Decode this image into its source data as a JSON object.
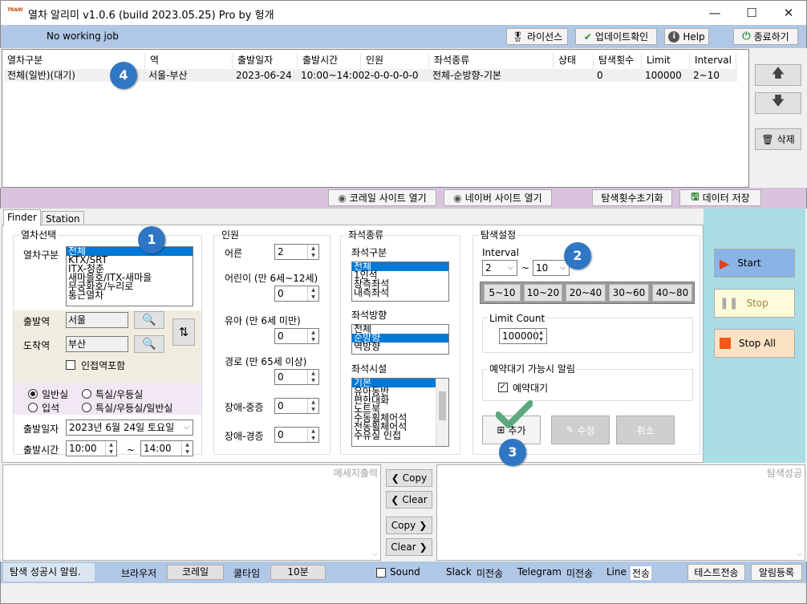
{
  "window": {
    "app_icon_text": "TRAIN",
    "title": "열차 알리미 v1.0.6 (build 2023.05.25) Pro by 헝개",
    "min": "—",
    "max": "☐",
    "close": "✕"
  },
  "statusbar": {
    "text": "No working job",
    "license": "라이선스",
    "update": "업데이트확인",
    "help": "Help",
    "quit": "종료하기"
  },
  "jobs": {
    "columns": [
      "열차구분",
      "역",
      "출발일자",
      "출발시간",
      "인원",
      "좌석종류",
      "상태",
      "탐색횟수",
      "Limit",
      "Interval"
    ],
    "rows": [
      [
        "전체(일반)(대기)",
        "서울-부산",
        "2023-06-24",
        "10:00~14:00",
        "2-0-0-0-0-0",
        "전체-순방향-기본",
        "",
        "0",
        "100000",
        "2~10"
      ]
    ],
    "delete": "삭제"
  },
  "midbar": {
    "korail": "코레일 사이트 열기",
    "naver": "네이버 사이트 열기",
    "reset": "탐색횟수초기화",
    "save": "데이터 저장"
  },
  "tabs": [
    "Finder",
    "Station"
  ],
  "train": {
    "group": "열차선택",
    "type_label": "열차구분",
    "types": [
      "전체",
      "KTX/SRT",
      "ITX-청춘",
      "새마을호/ITX-새마을",
      "무궁화호/누리로",
      "통근열차"
    ],
    "dep_label": "출발역",
    "dep": "서울",
    "arr_label": "도착역",
    "arr": "부산",
    "near": "인접역포함",
    "r_general": "일반실",
    "r_special": "특실/우등실",
    "r_stand": "입석",
    "r_special2": "특실/우등실/일반실",
    "date_label": "출발일자",
    "date": "2023년  6월 24일 토요일",
    "time_label": "출발시간",
    "time_from": "10:00",
    "tilde": "~",
    "time_to": "14:00"
  },
  "people": {
    "group": "인원",
    "adult": "어른",
    "adult_v": "2",
    "child": "어린이 (만 6세~12세)",
    "child_v": "0",
    "infant": "유아 (만 6세 미만)",
    "infant_v": "0",
    "senior": "경로 (만 65세 이상)",
    "senior_v": "0",
    "dis1": "장애-중증",
    "dis1_v": "0",
    "dis2": "장애-경증",
    "dis2_v": "0"
  },
  "seat": {
    "group": "좌석종류",
    "kind_label": "좌석구분",
    "kinds": [
      "전체",
      "1인석",
      "창측좌석",
      "내측좌석"
    ],
    "dir_label": "좌석방향",
    "dirs": [
      "전체",
      "순방향",
      "역방향"
    ],
    "fac_label": "좌석시설",
    "facs": [
      "기본",
      "유아동반",
      "편한대화",
      "노트북",
      "수동휠체어석",
      "전동휠체어석",
      "수유실 인접"
    ]
  },
  "search": {
    "group": "탐색설정",
    "interval_label": "Interval",
    "int_from": "2",
    "tilde": "~",
    "int_to": "10",
    "presets": [
      "5~10",
      "10~20",
      "20~40",
      "30~60",
      "40~80"
    ],
    "limit_label": "Limit Count",
    "limit": "100000",
    "wait_group": "예약대기 가능시 알림",
    "wait": "예약대기",
    "add": "추가",
    "edit": "수정",
    "cancel": "취소"
  },
  "control": {
    "start": "Start",
    "stop": "Stop",
    "stop_all": "Stop All"
  },
  "colors": {
    "start_bg": "#8ab4e6",
    "stop_bg": "#fdfbd9",
    "stopall_bg": "#fbe2c4",
    "badge": "#2f77c4",
    "check": "#5da87e"
  },
  "output": {
    "msg_label": "메세지출력",
    "success_label": "탐색성공",
    "copy": "Copy",
    "clear": "Clear"
  },
  "footer": {
    "notify": "탐색 성공시 알림.",
    "browser_label": "브라우저",
    "browser": "코레일",
    "cool_label": "쿨타임",
    "cool": "10분",
    "sound": "Sound",
    "slack_label": "Slack",
    "slack": "미전송",
    "tg_label": "Telegram",
    "tg": "미전송",
    "line_label": "Line",
    "line": "전송",
    "test": "테스트전송",
    "register": "알림등록"
  },
  "badges": [
    "1",
    "2",
    "3",
    "4"
  ]
}
